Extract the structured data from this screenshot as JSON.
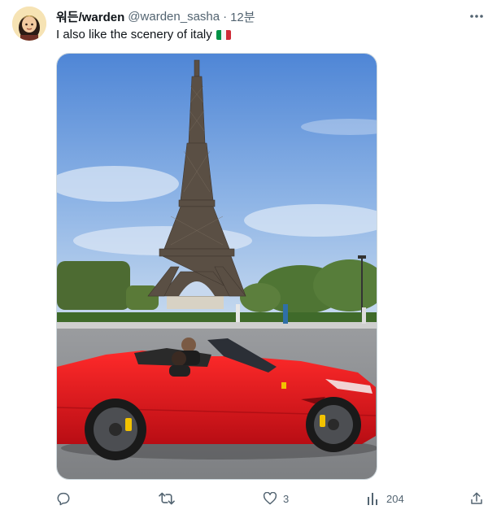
{
  "author": {
    "display_name": "워든/warden",
    "handle": "@warden_sasha",
    "separator": "·",
    "time": "12분"
  },
  "tweet": {
    "text": "I also like the scenery of italy",
    "flag_colors": [
      "#009246",
      "#ffffff",
      "#ce2b37"
    ]
  },
  "media": {
    "alt_description_icon": "photo-eiffel-tower-red-convertible"
  },
  "actions": {
    "reply_count": "",
    "retweet_count": "",
    "like_count": "3",
    "views_count": "204"
  },
  "colors": {
    "text_primary": "#0f1419",
    "text_secondary": "#536471",
    "car_red": "#e3121b",
    "sky": "#6f9fdc"
  }
}
